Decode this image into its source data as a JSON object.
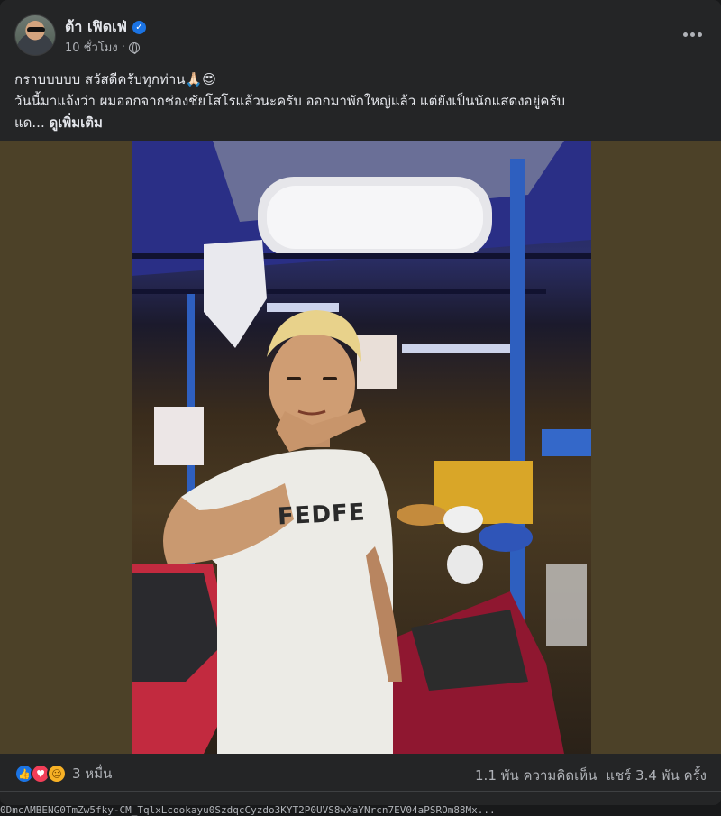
{
  "post": {
    "author": "ต้า เฟิดเฟ่",
    "time": "10 ชั่วโมง",
    "separator": "·",
    "text_line1": "กราบบบบบ สวัสดีครับทุกท่าน🙏🏻😍",
    "text_line2": "วันนี้มาแจ้งว่า ผมออกจากช่องชัยโสโรแล้วนะครับ ออกมาพักใหญ่แล้ว แต่ยังเป็นนักแสดงอยู่ครับ",
    "text_line3_prefix": "แด...",
    "see_more": "ดูเพิ่มเติม"
  },
  "photo": {
    "shirt_text": "FEDFE"
  },
  "footer": {
    "reaction_count": "3 หมื่น",
    "comments": "1.1 พัน ความคิดเห็น",
    "shares": "แชร์ 3.4 พัน ครั้ง"
  },
  "url_strip": "0DmcAMBENG0TmZw5fky-CM_TqlxLcookayu0SzdqcCyzdo3KYT2P0UVS8wXaYNrcn7EV04aPSROm88Mx...",
  "colors": {
    "verified": "#1b74e4",
    "like": "#1b74e4",
    "love": "#f33e58",
    "care": "#f7b125"
  },
  "icons": {
    "verified": "verified-badge-icon",
    "privacy": "globe-icon",
    "more": "more-options-icon"
  }
}
